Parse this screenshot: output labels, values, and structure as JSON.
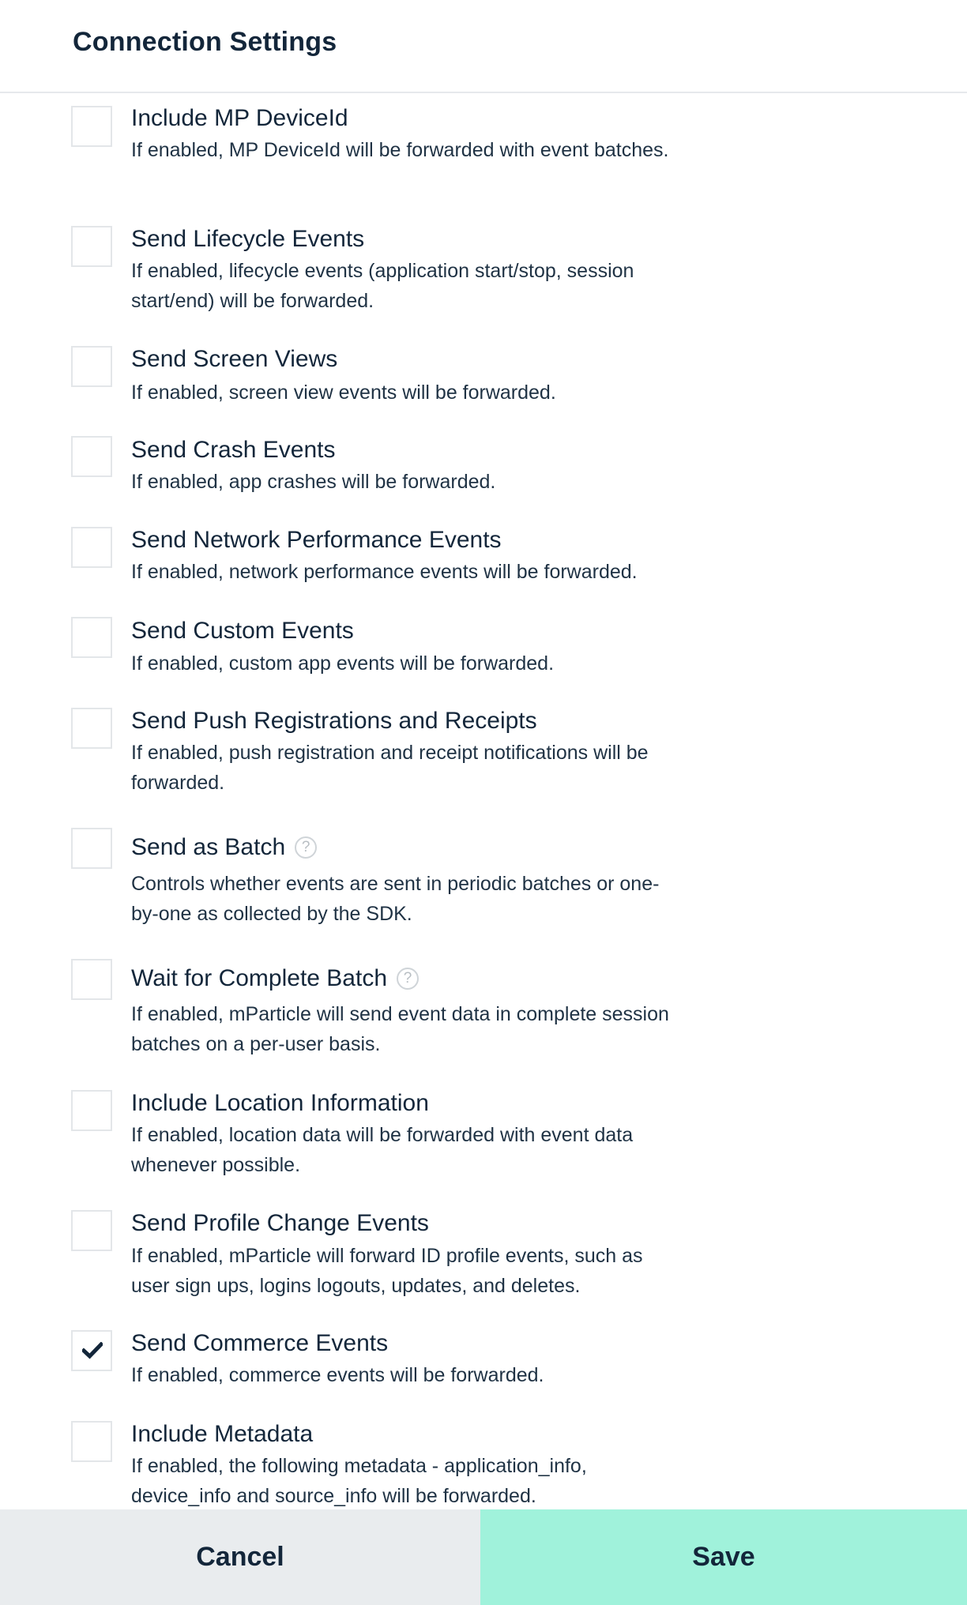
{
  "header": {
    "title": "Connection Settings"
  },
  "settings": [
    {
      "title": "Include MP DeviceId",
      "description": "If enabled, MP DeviceId will be forwarded with event batches.",
      "checked": false,
      "help": false
    },
    {
      "title": "Send Lifecycle Events",
      "description": "If enabled, lifecycle events (application start/stop, session start/end) will be forwarded.",
      "checked": false,
      "help": false
    },
    {
      "title": "Send Screen Views",
      "description": "If enabled, screen view events will be forwarded.",
      "checked": false,
      "help": false
    },
    {
      "title": "Send Crash Events",
      "description": "If enabled, app crashes will be forwarded.",
      "checked": false,
      "help": false
    },
    {
      "title": "Send Network Performance Events",
      "description": "If enabled, network performance events will be forwarded.",
      "checked": false,
      "help": false
    },
    {
      "title": "Send Custom Events",
      "description": "If enabled, custom app events will be forwarded.",
      "checked": false,
      "help": false
    },
    {
      "title": "Send Push Registrations and Receipts",
      "description": "If enabled, push registration and receipt notifications will be forwarded.",
      "checked": false,
      "help": false
    },
    {
      "title": "Send as Batch",
      "description": "Controls whether events are sent in periodic batches or one-by-one as collected by the SDK.",
      "checked": false,
      "help": true
    },
    {
      "title": "Wait for Complete Batch",
      "description": "If enabled, mParticle will send event data in complete session batches on a per-user basis.",
      "checked": false,
      "help": true
    },
    {
      "title": "Include Location Information",
      "description": "If enabled, location data will be forwarded with event data whenever possible.",
      "checked": false,
      "help": false
    },
    {
      "title": "Send Profile Change Events",
      "description": "If enabled, mParticle will forward ID profile events, such as user sign ups, logins logouts, updates, and deletes.",
      "checked": false,
      "help": false
    },
    {
      "title": "Send Commerce Events",
      "description": "If enabled, commerce events will be forwarded.",
      "checked": true,
      "help": false
    },
    {
      "title": "Include Metadata",
      "description": "If enabled, the following metadata - application_info, device_info and source_info will be forwarded.",
      "checked": false,
      "help": false
    }
  ],
  "help_icon": {
    "glyph": "?"
  },
  "footer": {
    "cancel_label": "Cancel",
    "save_label": "Save"
  },
  "colors": {
    "text": "#13263a",
    "cancel_bg": "#e9ecee",
    "save_bg": "#a0f2db",
    "checkbox_border": "#e3e6e9"
  }
}
